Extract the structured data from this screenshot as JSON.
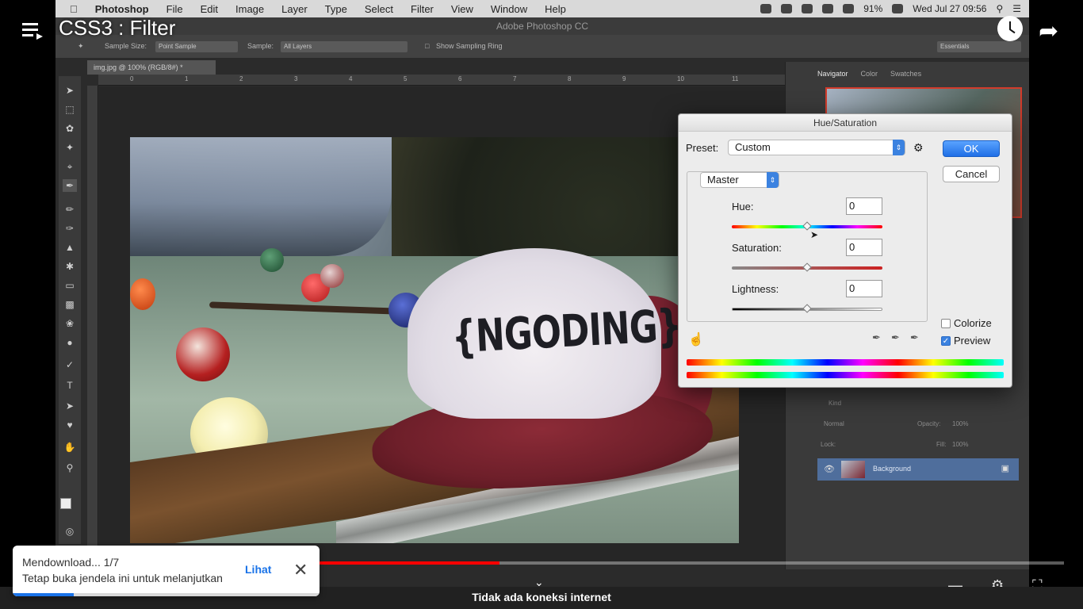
{
  "video": {
    "title": "CSS3 : Filter",
    "progress_fraction": 0.46
  },
  "mac_menubar": {
    "items": [
      "Photoshop",
      "File",
      "Edit",
      "Image",
      "Layer",
      "Type",
      "Select",
      "Filter",
      "View",
      "Window",
      "Help"
    ],
    "battery": "91%",
    "clock": "Wed Jul 27  09:56"
  },
  "photoshop": {
    "window_title": "Adobe Photoshop CC",
    "options": {
      "sample_size_label": "Sample Size:",
      "sample_size_value": "Point Sample",
      "sample_label": "Sample:",
      "sample_value": "All Layers",
      "show_ring": "Show Sampling Ring",
      "workspace": "Essentials"
    },
    "doc_tab": "img.jpg @ 100% (RGB/8#) *",
    "ruler_numbers": [
      "0",
      "1",
      "2",
      "3",
      "4",
      "5",
      "6",
      "7",
      "8",
      "9",
      "10",
      "11"
    ],
    "photo_text": "{NGODING}",
    "panel_tabs": [
      "Navigator",
      "Color",
      "Swatches"
    ],
    "layers": {
      "kind_label": "Kind",
      "blend_mode": "Normal",
      "opacity_label": "Opacity:",
      "opacity_value": "100%",
      "lock_label": "Lock:",
      "fill_label": "Fill:",
      "fill_value": "100%",
      "layer_name": "Background"
    }
  },
  "hue_saturation_dialog": {
    "title": "Hue/Saturation",
    "preset_label": "Preset:",
    "preset_value": "Custom",
    "channel": "Master",
    "ok_label": "OK",
    "cancel_label": "Cancel",
    "hue_label": "Hue:",
    "hue_value": "0",
    "saturation_label": "Saturation:",
    "saturation_value": "0",
    "lightness_label": "Lightness:",
    "lightness_value": "0",
    "colorize_label": "Colorize",
    "colorize_checked": false,
    "preview_label": "Preview",
    "preview_checked": true
  },
  "download_toast": {
    "status": "Mendownload... 1/7",
    "message": "Tetap buka jendela ini untuk melanjutkan",
    "action": "Lihat",
    "progress_fraction": 0.2
  },
  "status_bar": {
    "text": "Tidak ada koneksi internet"
  },
  "colors": {
    "progress_red": "#ff0000",
    "accent_blue": "#1a73e8",
    "ok_button_blue": "#1f6fe6"
  }
}
